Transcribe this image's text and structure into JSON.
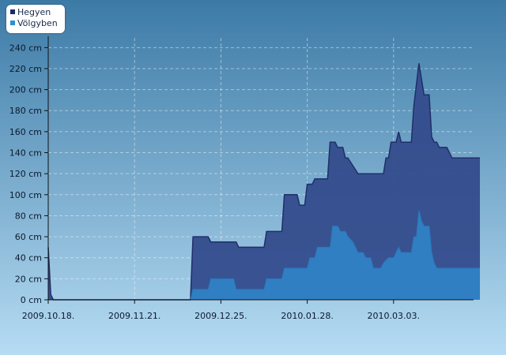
{
  "colors": {
    "background_top": "#3c7aa6",
    "background_bottom": "#b6dcf3",
    "hegyen": "#344c8c",
    "hegyen_line": "#1f2f6a",
    "volgyben": "#2f7fc2",
    "axis": "#111111",
    "grid": "#ffffff",
    "label": "#0c1a30"
  },
  "legend": [
    {
      "name": "Hegyen",
      "color": "#1c2a66"
    },
    {
      "name": "Völgyben",
      "color": "#2f8fd0"
    }
  ],
  "chart_data": {
    "type": "area",
    "xlabel": "",
    "ylabel": "",
    "y_unit": "cm",
    "ylim": [
      0,
      245
    ],
    "yticks": [
      0,
      20,
      40,
      60,
      80,
      100,
      120,
      140,
      160,
      180,
      200,
      220,
      240
    ],
    "xlim": [
      "2009-10-18",
      "2010-04-06"
    ],
    "xticks": [
      "2009-10-18",
      "2009-11-21",
      "2009-12-25",
      "2010-01-28",
      "2010-03-03"
    ],
    "xtick_labels": [
      "2009.10.18.",
      "2009.11.21.",
      "2009.12.25.",
      "2010.01.28.",
      "2010.03.03."
    ],
    "grid": true,
    "legend_position": "top-left",
    "series": [
      {
        "name": "Hegyen",
        "points": [
          [
            "2009-10-18",
            50
          ],
          [
            "2009-10-19",
            5
          ],
          [
            "2009-10-20",
            0
          ],
          [
            "2009-12-13",
            0
          ],
          [
            "2009-12-14",
            60
          ],
          [
            "2009-12-20",
            60
          ],
          [
            "2009-12-21",
            55
          ],
          [
            "2009-12-31",
            55
          ],
          [
            "2010-01-01",
            50
          ],
          [
            "2010-01-11",
            50
          ],
          [
            "2010-01-12",
            65
          ],
          [
            "2010-01-18",
            65
          ],
          [
            "2010-01-19",
            100
          ],
          [
            "2010-01-24",
            100
          ],
          [
            "2010-01-25",
            90
          ],
          [
            "2010-01-27",
            90
          ],
          [
            "2010-01-28",
            110
          ],
          [
            "2010-01-30",
            110
          ],
          [
            "2010-01-31",
            115
          ],
          [
            "2010-02-05",
            115
          ],
          [
            "2010-02-06",
            150
          ],
          [
            "2010-02-08",
            150
          ],
          [
            "2010-02-09",
            145
          ],
          [
            "2010-02-11",
            145
          ],
          [
            "2010-02-12",
            135
          ],
          [
            "2010-02-13",
            135
          ],
          [
            "2010-02-17",
            120
          ],
          [
            "2010-02-27",
            120
          ],
          [
            "2010-02-28",
            135
          ],
          [
            "2010-03-01",
            135
          ],
          [
            "2010-03-02",
            150
          ],
          [
            "2010-03-04",
            150
          ],
          [
            "2010-03-05",
            160
          ],
          [
            "2010-03-06",
            150
          ],
          [
            "2010-03-10",
            150
          ],
          [
            "2010-03-11",
            185
          ],
          [
            "2010-03-13",
            225
          ],
          [
            "2010-03-15",
            195
          ],
          [
            "2010-03-17",
            195
          ],
          [
            "2010-03-18",
            155
          ],
          [
            "2010-03-19",
            150
          ],
          [
            "2010-03-20",
            150
          ],
          [
            "2010-03-21",
            145
          ],
          [
            "2010-03-24",
            145
          ],
          [
            "2010-03-26",
            135
          ],
          [
            "2010-04-06",
            135
          ]
        ]
      },
      {
        "name": "Völgyben",
        "points": [
          [
            "2009-10-18",
            0
          ],
          [
            "2009-12-13",
            0
          ],
          [
            "2009-12-14",
            10
          ],
          [
            "2009-12-20",
            10
          ],
          [
            "2009-12-21",
            20
          ],
          [
            "2009-12-30",
            20
          ],
          [
            "2009-12-31",
            10
          ],
          [
            "2010-01-11",
            10
          ],
          [
            "2010-01-12",
            20
          ],
          [
            "2010-01-18",
            20
          ],
          [
            "2010-01-19",
            30
          ],
          [
            "2010-01-28",
            30
          ],
          [
            "2010-01-29",
            40
          ],
          [
            "2010-01-31",
            40
          ],
          [
            "2010-02-01",
            50
          ],
          [
            "2010-02-06",
            50
          ],
          [
            "2010-02-07",
            70
          ],
          [
            "2010-02-09",
            70
          ],
          [
            "2010-02-10",
            65
          ],
          [
            "2010-02-12",
            65
          ],
          [
            "2010-02-13",
            60
          ],
          [
            "2010-02-15",
            55
          ],
          [
            "2010-02-17",
            45
          ],
          [
            "2010-02-19",
            45
          ],
          [
            "2010-02-20",
            40
          ],
          [
            "2010-02-22",
            40
          ],
          [
            "2010-02-23",
            30
          ],
          [
            "2010-02-26",
            30
          ],
          [
            "2010-02-27",
            35
          ],
          [
            "2010-03-01",
            40
          ],
          [
            "2010-03-03",
            40
          ],
          [
            "2010-03-05",
            50
          ],
          [
            "2010-03-06",
            45
          ],
          [
            "2010-03-10",
            45
          ],
          [
            "2010-03-11",
            60
          ],
          [
            "2010-03-12",
            60
          ],
          [
            "2010-03-13",
            85
          ],
          [
            "2010-03-14",
            75
          ],
          [
            "2010-03-15",
            70
          ],
          [
            "2010-03-17",
            70
          ],
          [
            "2010-03-18",
            45
          ],
          [
            "2010-03-19",
            35
          ],
          [
            "2010-03-20",
            30
          ],
          [
            "2010-04-06",
            30
          ]
        ]
      }
    ]
  }
}
